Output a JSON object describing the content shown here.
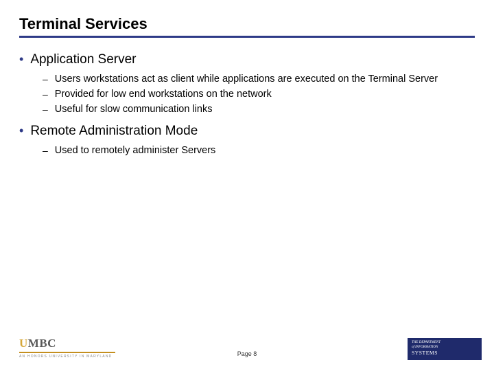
{
  "title": "Terminal Services",
  "sections": [
    {
      "label": "Application Server",
      "items": [
        "Users workstations act as client while applications are executed on the Terminal Server",
        "Provided for low end workstations on the network",
        "Useful for slow communication links"
      ]
    },
    {
      "label": "Remote Administration Mode",
      "items": [
        "Used to remotely administer Servers"
      ]
    }
  ],
  "footer": {
    "page_label": "Page 8",
    "logo_text": {
      "u": "U",
      "rest": "MBC"
    },
    "tagline": "AN HONORS UNIVERSITY IN MARYLAND",
    "dept": {
      "l1": "THE",
      "l2": "DEPARTMENT",
      "l3": "of",
      "l4": "INFORMATION",
      "l5": "SYSTEMS"
    }
  },
  "colors": {
    "accent": "#2e3a87",
    "gold": "#c48f1f"
  }
}
